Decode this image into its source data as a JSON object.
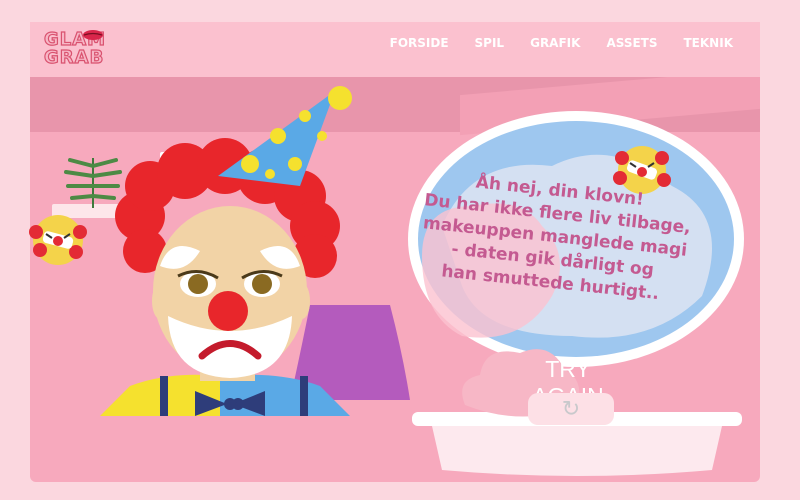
{
  "logo": {
    "text_line1": "GLAM",
    "text_line2": "GRAB"
  },
  "nav": [
    {
      "label": "FORSIDE"
    },
    {
      "label": "SPIL"
    },
    {
      "label": "GRAFIK"
    },
    {
      "label": "ASSETS"
    },
    {
      "label": "TEKNIK"
    }
  ],
  "game": {
    "message_lines": [
      "Åh nej, din klovn!",
      "Du har ikke flere liv tilbage,",
      "makeuppen manglede magi",
      "- daten gik dårligt og",
      "han smuttede hurtigt.."
    ],
    "try_again": "TRY AGAIN",
    "reload_icon": "reload-icon"
  },
  "colors": {
    "background": "#fbd7df",
    "room": "#f7a9bd",
    "header": "#fbc1cf",
    "message": "#c45a91",
    "clown_hair": "#e8262b",
    "clown_hat": "#5aa9e6",
    "hat_dots": "#f5e12e"
  }
}
